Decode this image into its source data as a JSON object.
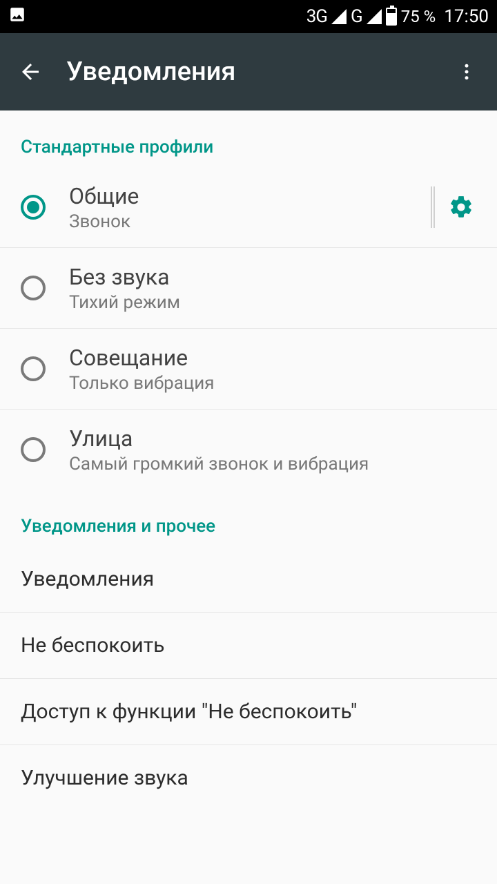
{
  "status": {
    "net1_label": "3G",
    "net2_label": "G",
    "battery_pct": "75 %",
    "time": "17:50"
  },
  "appbar": {
    "title": "Уведомления"
  },
  "sections": {
    "standard_header": "Стандартные профили",
    "other_header": "Уведомления и прочее"
  },
  "profiles": [
    {
      "title": "Общие",
      "sub": "Звонок",
      "selected": true,
      "has_gear": true
    },
    {
      "title": "Без звука",
      "sub": "Тихий режим",
      "selected": false,
      "has_gear": false
    },
    {
      "title": "Совещание",
      "sub": "Только вибрация",
      "selected": false,
      "has_gear": false
    },
    {
      "title": "Улица",
      "sub": "Самый громкий звонок и вибрация",
      "selected": false,
      "has_gear": false
    }
  ],
  "other_items": [
    "Уведомления",
    "Не беспокоить",
    "Доступ к функции \"Не беспокоить\"",
    "Улучшение звука"
  ]
}
